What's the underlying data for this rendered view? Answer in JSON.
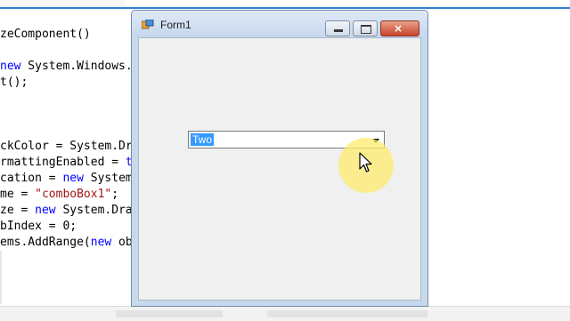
{
  "editor": {
    "lines": [
      {
        "parts": [
          {
            "t": "zeComponent()",
            "c": ""
          }
        ]
      },
      {
        "parts": [
          {
            "t": "new",
            "c": "kw"
          },
          {
            "t": " System.Windows.",
            "c": ""
          }
        ]
      },
      {
        "parts": [
          {
            "t": "t();",
            "c": ""
          }
        ]
      },
      {
        "parts": [
          {
            "t": "ckColor = System.Dr",
            "c": ""
          }
        ]
      },
      {
        "parts": [
          {
            "t": "rmattingEnabled = ",
            "c": ""
          },
          {
            "t": "t",
            "c": "kw"
          }
        ]
      },
      {
        "parts": [
          {
            "t": "cation = ",
            "c": ""
          },
          {
            "t": "new",
            "c": "kw"
          },
          {
            "t": " System",
            "c": ""
          }
        ]
      },
      {
        "parts": [
          {
            "t": "me = ",
            "c": ""
          },
          {
            "t": "\"comboBox1\"",
            "c": "str"
          },
          {
            "t": ";",
            "c": ""
          }
        ]
      },
      {
        "parts": [
          {
            "t": "ze = ",
            "c": ""
          },
          {
            "t": "new",
            "c": "kw"
          },
          {
            "t": " System.Draw",
            "c": ""
          }
        ]
      },
      {
        "parts": [
          {
            "t": "bIndex = 0;",
            "c": ""
          }
        ]
      },
      {
        "parts": [
          {
            "t": "ems.AddRange(",
            "c": ""
          },
          {
            "t": "new",
            "c": "kw"
          },
          {
            "t": " ob",
            "c": ""
          }
        ]
      }
    ]
  },
  "window": {
    "title": "Form1",
    "controls": {
      "minimize": "minimize-icon",
      "maximize": "maximize-icon",
      "close": "×"
    }
  },
  "combo": {
    "selected_value": "Two"
  },
  "colors": {
    "selection": "#3399ff",
    "keyword": "#0000ff",
    "string": "#a31515",
    "cursor_highlight": "#ffec6e"
  }
}
